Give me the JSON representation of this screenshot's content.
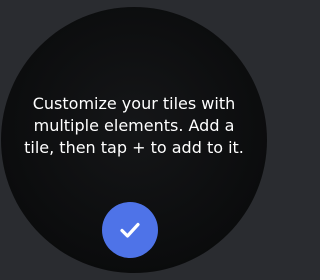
{
  "tile_editor_prompt": {
    "message": "Customize your tiles with multiple elements. Add a tile, then tap + to add to it.",
    "confirm_icon": "check-icon",
    "colors": {
      "background": "#2a2c30",
      "watch_face": "#0b0c0d",
      "text": "#ffffff",
      "accent": "#4e73e8",
      "icon": "#ffffff"
    }
  }
}
